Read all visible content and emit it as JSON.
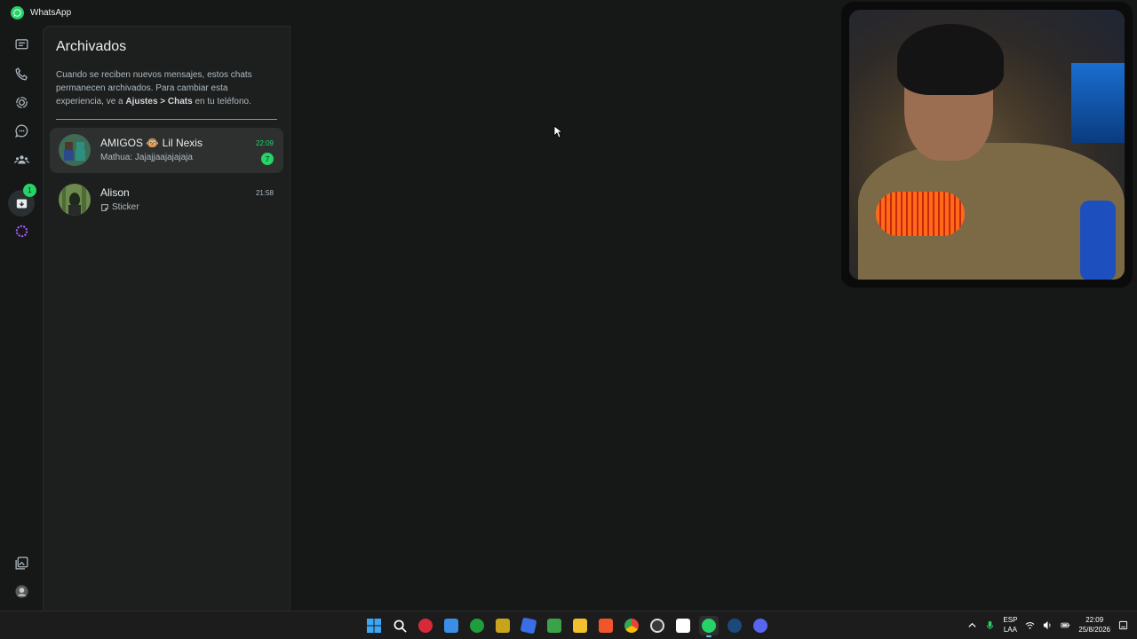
{
  "app": {
    "title": "WhatsApp"
  },
  "rail": {
    "archived_badge": "1"
  },
  "panel": {
    "title": "Archivados",
    "desc_part1": "Cuando se reciben nuevos mensajes, estos chats permanecen archivados. Para cambiar esta experiencia, ve a ",
    "desc_bold": "Ajustes > Chats",
    "desc_part2": " en tu teléfono."
  },
  "chats": [
    {
      "name": "AMIGOS 🐵 Lil Nexis",
      "preview": "Mathua: Jajajjaajajajaja",
      "time": "22:09",
      "unread": "7"
    },
    {
      "name": "Alison",
      "preview": "Sticker",
      "time": "21:58"
    }
  ],
  "taskbar": {
    "lang_line1": "ESP",
    "lang_line2": "LAA",
    "time": "22:09",
    "date": "25/8/2026"
  },
  "colors": {
    "accent": "#25d366",
    "background": "#161717",
    "panel": "#1d1f1f"
  }
}
